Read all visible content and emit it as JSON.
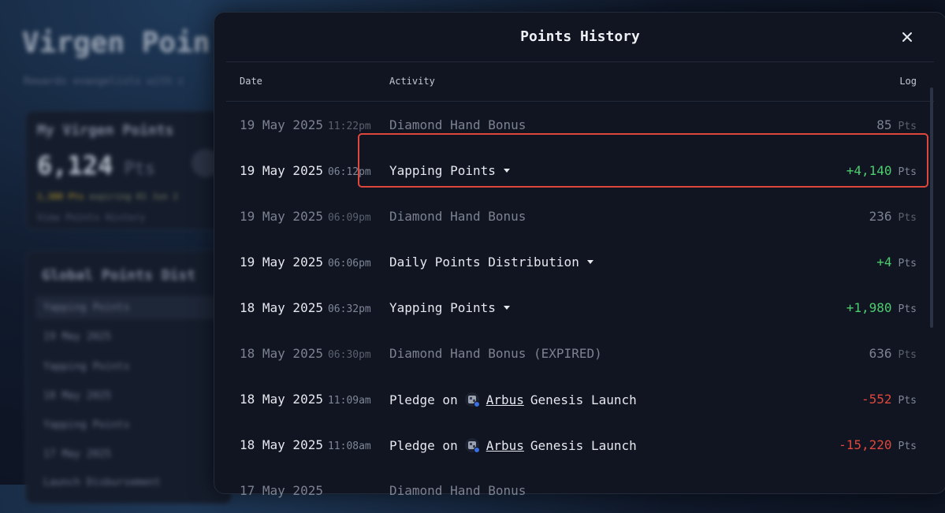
{
  "background": {
    "title": "Virgen Poin",
    "subtitle": "Rewards evangelists with c",
    "points_card": {
      "title": "My Virgen Points",
      "value": "6,124",
      "unit": "Pts",
      "expiry_amount": "1,380 Pts",
      "expiry_text": "expiring 01 Jun 2",
      "link": "View Points History"
    },
    "distribution_card": {
      "title": "Global Points Dist",
      "items": [
        "Yapping Points",
        "19 May 2025",
        "Yapping Points",
        "18 May 2025",
        "Yapping Points",
        "17 May 2025",
        "Launch Disbursement"
      ]
    }
  },
  "modal": {
    "title": "Points History",
    "close_icon": "close-icon",
    "columns": {
      "date": "Date",
      "activity": "Activity",
      "log": "Log"
    },
    "rows": [
      {
        "date": "19 May 2025",
        "time": "11:22pm",
        "activity": "Diamond Hand Bonus",
        "value": "85",
        "unit": "Pts",
        "style": "dim",
        "sign": "neutral",
        "expandable": false
      },
      {
        "date": "19 May 2025",
        "time": "06:12pm",
        "activity": "Yapping Points",
        "value": "+4,140",
        "unit": "Pts",
        "style": "normal",
        "sign": "pos",
        "expandable": true
      },
      {
        "date": "19 May 2025",
        "time": "06:09pm",
        "activity": "Diamond Hand Bonus",
        "value": "236",
        "unit": "Pts",
        "style": "dim",
        "sign": "neutral",
        "expandable": false
      },
      {
        "date": "19 May 2025",
        "time": "06:06pm",
        "activity": "Daily Points Distribution",
        "value": "+4",
        "unit": "Pts",
        "style": "normal",
        "sign": "pos",
        "expandable": true
      },
      {
        "date": "18 May 2025",
        "time": "06:32pm",
        "activity": "Yapping Points",
        "value": "+1,980",
        "unit": "Pts",
        "style": "normal",
        "sign": "pos",
        "expandable": true
      },
      {
        "date": "18 May 2025",
        "time": "06:30pm",
        "activity": "Diamond Hand Bonus (EXPIRED)",
        "value": "636",
        "unit": "Pts",
        "style": "dim",
        "sign": "neutral",
        "expandable": false
      },
      {
        "date": "18 May 2025",
        "time": "11:09am",
        "activity_prefix": "Pledge on",
        "activity_link": "Arbus",
        "activity_suffix": "Genesis Launch",
        "value": "-552",
        "unit": "Pts",
        "style": "normal",
        "sign": "neg",
        "expandable": false
      },
      {
        "date": "18 May 2025",
        "time": "11:08am",
        "activity_prefix": "Pledge on",
        "activity_link": "Arbus",
        "activity_suffix": "Genesis Launch",
        "value": "-15,220",
        "unit": "Pts",
        "style": "normal",
        "sign": "neg",
        "expandable": false
      },
      {
        "date": "17 May 2025",
        "time": "",
        "activity": "Diamond Hand Bonus",
        "value": "",
        "unit": "",
        "style": "dim",
        "sign": "neutral",
        "expandable": false
      }
    ],
    "highlighted_row": 1
  },
  "colors": {
    "positive": "#4ccd6e",
    "negative": "#e0473c",
    "highlight": "#e0473c",
    "modal_bg": "#101521"
  }
}
